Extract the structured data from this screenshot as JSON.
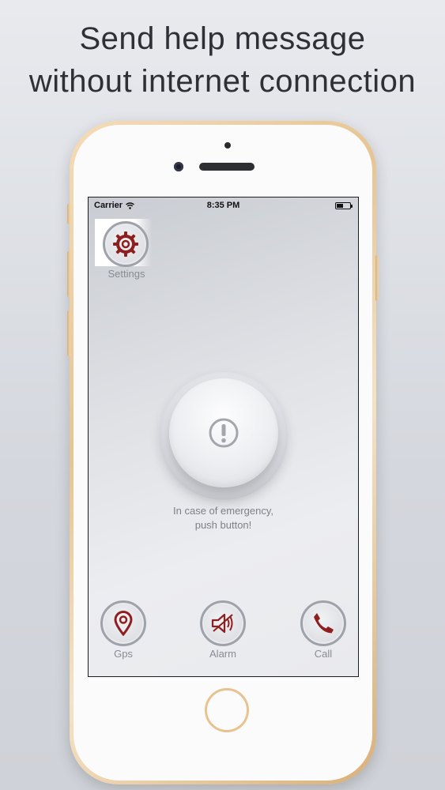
{
  "headline": {
    "line1": "Send help message",
    "line2": "without internet connection"
  },
  "status_bar": {
    "carrier": "Carrier",
    "time": "8:35 PM",
    "battery_level": 0.5
  },
  "settings": {
    "label": "Settings",
    "icon": "gear-icon"
  },
  "panic_button": {
    "icon": "exclamation-icon",
    "caption_line1": "In case of emergency,",
    "caption_line2": "push button!"
  },
  "bottom_bar": {
    "items": [
      {
        "label": "Gps",
        "icon": "map-pin-icon"
      },
      {
        "label": "Alarm",
        "icon": "speaker-icon"
      },
      {
        "label": "Call",
        "icon": "phone-icon"
      }
    ]
  },
  "colors": {
    "accent": "#8f1e1e",
    "icon_ring": "#9ea2a9",
    "label": "#888b92"
  }
}
